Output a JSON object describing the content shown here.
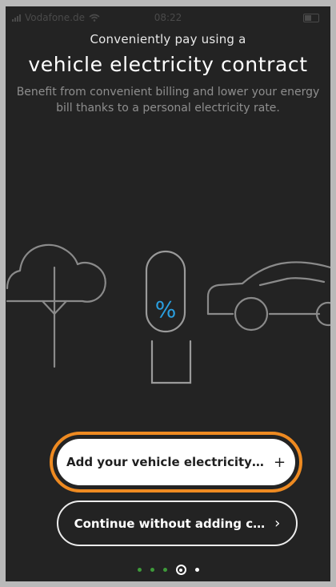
{
  "status_bar": {
    "carrier": "Vodafone.de",
    "time": "08:22"
  },
  "header": {
    "subtitle": "Conveniently pay using a",
    "title": "vehicle electricity contract",
    "description": "Benefit from convenient billing and lower your energy bill thanks to a personal electricity rate."
  },
  "illustration": {
    "badge_text": "%",
    "colors": {
      "line": "#8a8a8a",
      "accent": "#2a9fe0"
    },
    "icons": [
      "tree-icon",
      "charging-plug-icon",
      "car-icon"
    ]
  },
  "actions": {
    "primary_label": "Add your vehicle electricity…",
    "primary_icon": "+",
    "secondary_label": "Continue without adding c…",
    "secondary_icon": "›"
  },
  "pager": {
    "total": 5,
    "current": 4
  },
  "colors": {
    "background": "#232323",
    "highlight": "#ee8a21",
    "progress_dot": "#3e9a3a"
  }
}
